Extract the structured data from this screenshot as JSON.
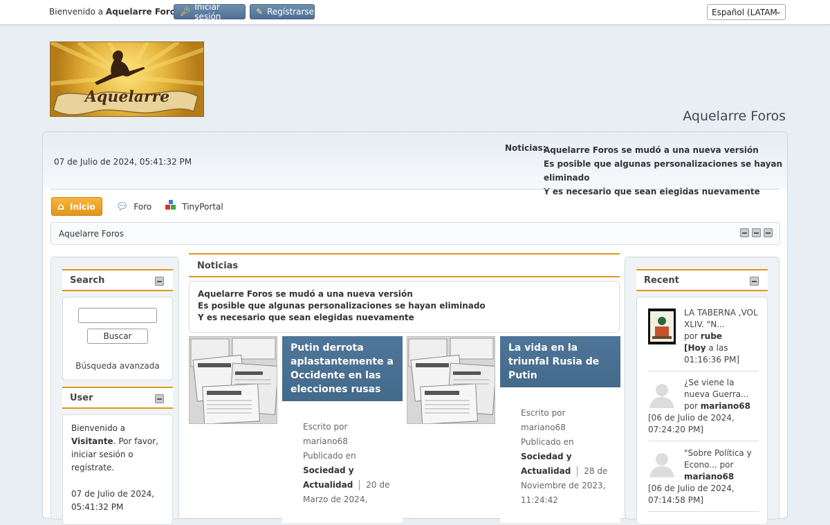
{
  "topbar": {
    "welcome_prefix": "Bienvenido a ",
    "welcome_site": "Aquelarre Foros",
    "welcome_suffix": ".",
    "login_label": "Iniciar sesión",
    "register_label": "Regístrarse",
    "language": "Español (LATAM"
  },
  "site": {
    "title": "Aquelarre Foros",
    "logo_text": "Aquelarre"
  },
  "header": {
    "date": "07 de Julio de 2024, 05:41:32 PM",
    "news_label": "Noticias:",
    "news_lines": [
      "Aquelarre Foros se mudó a una nueva versión",
      "Es posible que algunas personalizaciones se hayan eliminado",
      "Y es necesario que sean elegidas nuevamente"
    ]
  },
  "nav": {
    "items": [
      {
        "label": "Inicio",
        "icon": "home-icon"
      },
      {
        "label": "Foro",
        "icon": "forum-icon"
      },
      {
        "label": "TinyPortal",
        "icon": "portal-icon"
      }
    ]
  },
  "breadcrumb": "Aquelarre Foros",
  "left": {
    "search": {
      "title": "Search",
      "button": "Buscar",
      "advanced": "Búsqueda avanzada"
    },
    "user": {
      "title": "User",
      "line1": "Bienvenido a",
      "visitor": "Visitante",
      "line2": ". Por favor, iniciar sesión o regístrate.",
      "date": "07 de Julio de 2024, 05:41:32 PM"
    }
  },
  "center": {
    "title": "Noticias",
    "news_lines": [
      "Aquelarre Foros se mudó a una nueva versión",
      "Es posible que algunas personalizaciones se hayan eliminado",
      "Y es necesario que sean elegidas nuevamente"
    ],
    "articles": [
      {
        "title": "Putin derrota aplastantemente a Occidente en las elecciones rusas",
        "written_by": "Escrito por",
        "author": "mariano68",
        "published_in": "Publicado en",
        "category": "Sociedad y Actualidad",
        "date": "20 de Marzo de 2024,"
      },
      {
        "title": "La vida en la triunfal Rusia de Putin",
        "written_by": "Escrito por",
        "author": "mariano68",
        "published_in": "Publicado en",
        "category": "Sociedad y Actualidad",
        "date": "28 de Noviembre de 2023, 11:24:42"
      }
    ]
  },
  "right": {
    "title": "Recent",
    "items": [
      {
        "topic": "LA TABERNA ,VOL XLIV. \"N...",
        "by": "por",
        "user": "rube",
        "time_prefix": "[Hoy",
        "time": " a las 01:16:36 PM]"
      },
      {
        "topic": "¿Se viene la nueva Guerra...",
        "by": "por",
        "user": "mariano68",
        "time": "[06 de Julio de 2024, 07:24:20 PM]"
      },
      {
        "topic": "\"Sobre Política y Econo...",
        "by": "por",
        "user": "mariano68",
        "time": "[06 de Julio de 2024, 07:14:58 PM]"
      }
    ]
  }
}
